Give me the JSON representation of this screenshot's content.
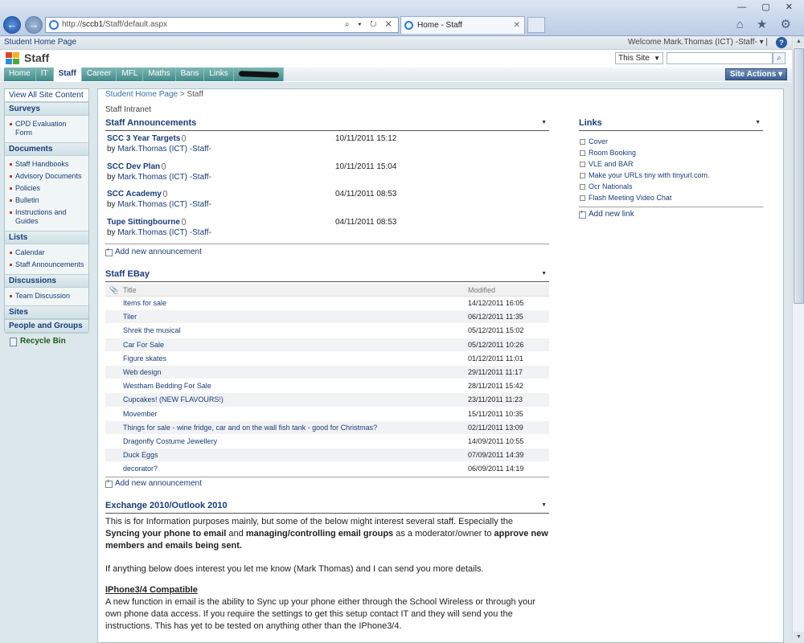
{
  "browser": {
    "url_prefix": "http://",
    "url_host": "sccb1",
    "url_path": "/Staff/default.aspx",
    "addr_buttons": "⌕ ▾ ↻ ✕",
    "tab_title": "Home - Staff",
    "tab_close": "✕",
    "window_controls": "— ▢ ✕",
    "tools_icons": "⌂ ★ ⚙"
  },
  "sp_top": {
    "breadcrumb_root": "Student Home Page",
    "welcome": "Welcome Mark.Thomas (ICT) -Staff- ▾ |",
    "help": "?"
  },
  "site": {
    "title": "Staff",
    "search_scope": "This Site",
    "search_scope_arrow": "▼",
    "search_btn": "⌕"
  },
  "nav": {
    "tabs": [
      "Home",
      "IT",
      "Staff",
      "Career",
      "MFL",
      "Maths",
      "Bans",
      "Links"
    ],
    "site_actions": "Site Actions ▾"
  },
  "quicklaunch": {
    "view_all": "View All Site Content",
    "sections": [
      {
        "head": "Surveys",
        "items": [
          "CPD Evaluation Form"
        ]
      },
      {
        "head": "Documents",
        "items": [
          "Staff Handbooks",
          "Advisory Documents",
          "Policies",
          "Bulletin",
          "Instructions and Guides"
        ]
      },
      {
        "head": "Lists",
        "items": [
          "Calendar",
          "Staff Announcements"
        ]
      },
      {
        "head": "Discussions",
        "items": [
          "Team Discussion"
        ]
      },
      {
        "head": "Sites",
        "items": []
      },
      {
        "head": "People and Groups",
        "items": []
      }
    ],
    "recycle": "Recycle Bin"
  },
  "content": {
    "breadcrumb_root": "Student Home Page",
    "breadcrumb_sep": " > ",
    "breadcrumb_current": "Staff",
    "page_title": "Staff Intranet",
    "menu_arrow": "▼"
  },
  "announcements": {
    "title": "Staff Announcements",
    "by_prefix": "by ",
    "items": [
      {
        "title": "SCC 3 Year Targets",
        "date": "10/11/2011 15:12",
        "author": "Mark.Thomas (ICT) -Staff-"
      },
      {
        "title": "SCC Dev Plan",
        "date": "10/11/2011 15:04",
        "author": "Mark.Thomas (ICT) -Staff-"
      },
      {
        "title": "SCC Academy",
        "date": "04/11/2011 08:53",
        "author": "Mark.Thomas (ICT) -Staff-"
      },
      {
        "title": "Tupe Sittingbourne",
        "date": "04/11/2011 08:53",
        "author": "Mark.Thomas (ICT) -Staff-"
      }
    ],
    "add_new": "Add new announcement"
  },
  "ebay": {
    "title": "Staff EBay",
    "col_title": "Title",
    "col_modified": "Modified",
    "rows": [
      {
        "title": "Items for sale",
        "modified": "14/12/2011 16:05"
      },
      {
        "title": "Tiler",
        "modified": "06/12/2011 11:35"
      },
      {
        "title": "Shrek the musical",
        "modified": "05/12/2011 15:02"
      },
      {
        "title": "Car For Sale",
        "modified": "05/12/2011 10:26"
      },
      {
        "title": "Figure skates",
        "modified": "01/12/2011 11:01"
      },
      {
        "title": "Web design",
        "modified": "29/11/2011 11:17"
      },
      {
        "title": "Westham Bedding For Sale",
        "modified": "28/11/2011 15:42"
      },
      {
        "title": "Cupcakes! (NEW FLAVOURS!)",
        "modified": "23/11/2011 11:23"
      },
      {
        "title": "Movember",
        "modified": "15/11/2011 10:35"
      },
      {
        "title": "Things for sale - wine fridge, car and on the wall fish tank - good for Christmas?",
        "modified": "02/11/2011 13:09"
      },
      {
        "title": "Dragonfly Costume Jewellery",
        "modified": "14/09/2011 10:55"
      },
      {
        "title": "Duck Eggs",
        "modified": "07/09/2011 14:39"
      },
      {
        "title": "decorator?",
        "modified": "06/09/2011 14:19"
      }
    ],
    "add_new": "Add new announcement"
  },
  "links": {
    "title": "Links",
    "items": [
      "Cover",
      "Room Booking",
      "VLE and BAR",
      "Make your URLs tiny with tinyurl.com.",
      "Ocr Nationals",
      "Flash Meeting Video Chat"
    ],
    "add_new": "Add new link"
  },
  "exchange": {
    "title": "Exchange 2010/Outlook 2010",
    "p1_a": "This is for Information purposes mainly, but some of the below might interest several staff.  Especially the ",
    "p1_b": "Syncing your phone to email",
    "p1_c": " and ",
    "p1_d": "managing/controlling email groups",
    "p1_e": " as a moderator/owner to ",
    "p1_f": "approve new members and emails being sent.",
    "p2": "If anything below does interest you let me know (Mark Thomas) and I can send you more details.",
    "h3": "IPhone3/4 Compatible",
    "p3": "A new function in email is the ability to Sync up your phone either through the School Wireless or through your own phone data access.  If you require the settings to get this setup contact IT and they will send you the instructions.  This has yet to be tested on anything other than the IPhone3/4."
  },
  "scroll": {
    "up": "▲",
    "down": "▼"
  }
}
